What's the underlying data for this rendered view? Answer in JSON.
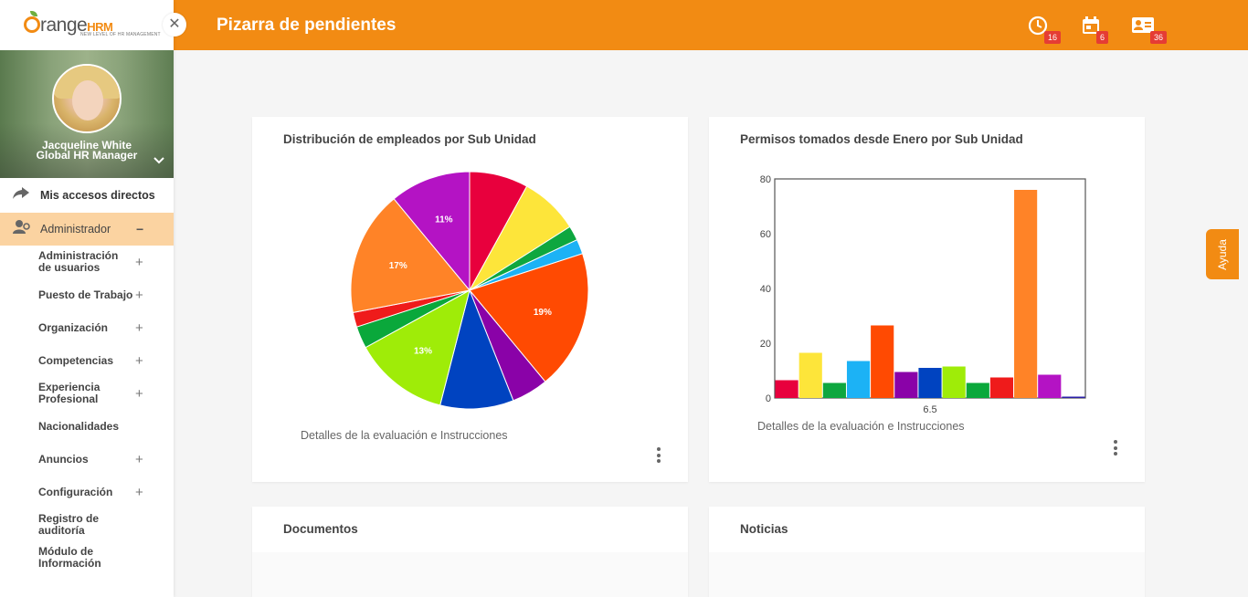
{
  "app": {
    "logo_text": "range",
    "logo_brand": "HRM",
    "logo_tagline": "NEW LEVEL OF HR MANAGEMENT",
    "close_icon": "close-icon"
  },
  "user": {
    "name": "Jacqueline White",
    "role": "Global HR Manager"
  },
  "sidebar": {
    "shortcuts": "Mis accesos directos",
    "admin": "Administrador",
    "items": [
      {
        "label": "Administración de usuarios",
        "expandable": true
      },
      {
        "label": "Puesto de Trabajo",
        "expandable": true
      },
      {
        "label": "Organización",
        "expandable": true
      },
      {
        "label": "Competencias",
        "expandable": true
      },
      {
        "label": "Experiencia Profesional",
        "expandable": true
      },
      {
        "label": "Nacionalidades",
        "expandable": false
      },
      {
        "label": "Anuncios",
        "expandable": true
      },
      {
        "label": "Configuración",
        "expandable": true
      },
      {
        "label": "Registro de auditoría",
        "expandable": false
      },
      {
        "label": "Módulo de Información",
        "expandable": false
      }
    ]
  },
  "header": {
    "title": "Pizarra de pendientes",
    "badges": {
      "clock": "16",
      "calendar": "6",
      "contacts": "36"
    }
  },
  "help": "Ayuda",
  "cards": {
    "pie_title": "Distribución de empleados por Sub Unidad",
    "pie_footer": "Detalles de la evaluación e Instrucciones",
    "bar_title": "Permisos tomados desde Enero por Sub Unidad",
    "bar_footer": "Detalles de la evaluación e Instrucciones",
    "docs_title": "Documentos",
    "news_title": "Noticias"
  },
  "colors": {
    "brand": "#f28b13",
    "badge": "#e53c34",
    "active_nav": "#fbd3a1"
  },
  "chart_data": [
    {
      "type": "pie",
      "title": "Distribución de empleados por Sub Unidad",
      "slices": [
        {
          "value": 8,
          "color": "#e8003d",
          "label": ""
        },
        {
          "value": 8,
          "color": "#fde53a",
          "label": ""
        },
        {
          "value": 2,
          "color": "#0ea73f",
          "label": ""
        },
        {
          "value": 2,
          "color": "#1cb2f5",
          "label": ""
        },
        {
          "value": 19,
          "color": "#ff4a02",
          "label": "19%"
        },
        {
          "value": 5,
          "color": "#8a02a8",
          "label": ""
        },
        {
          "value": 10,
          "color": "#0043c0",
          "label": ""
        },
        {
          "value": 13,
          "color": "#9fec08",
          "label": "13%"
        },
        {
          "value": 3,
          "color": "#0aa83b",
          "label": ""
        },
        {
          "value": 2,
          "color": "#ef1b1b",
          "label": ""
        },
        {
          "value": 17,
          "color": "#ff8327",
          "label": "17%"
        },
        {
          "value": 11,
          "color": "#b413c4",
          "label": "11%"
        }
      ]
    },
    {
      "type": "bar",
      "title": "Permisos tomados desde Enero por Sub Unidad",
      "categories": [
        "6.5"
      ],
      "ylim": [
        0,
        80
      ],
      "yticks": [
        "0",
        "20",
        "40",
        "60",
        "80"
      ],
      "series": [
        {
          "value": 6.5,
          "color": "#e8003d"
        },
        {
          "value": 16.5,
          "color": "#fde53a"
        },
        {
          "value": 5.5,
          "color": "#0ea73f"
        },
        {
          "value": 13.5,
          "color": "#1cb2f5"
        },
        {
          "value": 26.5,
          "color": "#ff4a02"
        },
        {
          "value": 9.5,
          "color": "#8a02a8"
        },
        {
          "value": 11,
          "color": "#0043c0"
        },
        {
          "value": 11.5,
          "color": "#9fec08"
        },
        {
          "value": 5.5,
          "color": "#0aa83b"
        },
        {
          "value": 7.5,
          "color": "#ef1b1b"
        },
        {
          "value": 76,
          "color": "#ff8327"
        },
        {
          "value": 8.5,
          "color": "#b413c4"
        },
        {
          "value": 0.5,
          "color": "#2a1fa8"
        }
      ]
    }
  ]
}
